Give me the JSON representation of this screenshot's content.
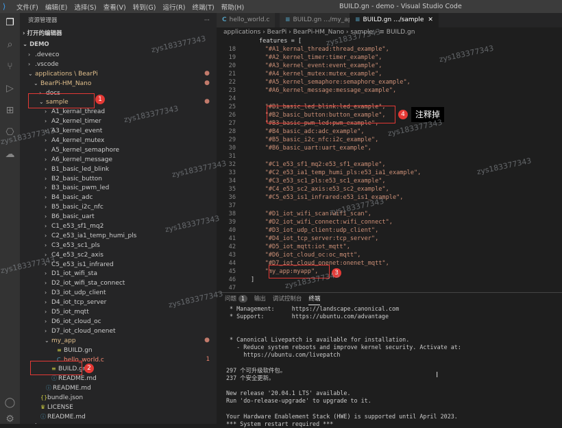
{
  "window": {
    "menu": [
      "文件(F)",
      "编辑(E)",
      "选择(S)",
      "查看(V)",
      "转到(G)",
      "运行(R)",
      "终端(T)",
      "帮助(H)"
    ],
    "title": "BUILD.gn - demo - Visual Studio Code"
  },
  "activity_icons": [
    "files-icon",
    "search-icon",
    "source-control-icon",
    "run-debug-icon",
    "extensions-icon",
    "remote-icon",
    "cloud-icon",
    "account-icon",
    "settings-gear-icon"
  ],
  "explorer": {
    "header": "资源管理器",
    "more": "···",
    "open_editors": "打开的编辑器",
    "workspace": "DEMO",
    "tree": [
      {
        "label": ".deveco",
        "depth": 1,
        "chev": "›"
      },
      {
        "label": ".vscode",
        "depth": 1,
        "chev": "›"
      },
      {
        "label": "applications \\ BearPi",
        "depth": 1,
        "chev": "⌄",
        "mod": true,
        "dot": "●"
      },
      {
        "label": "BearPi-HM_Nano",
        "depth": 2,
        "chev": "⌄",
        "mod": true,
        "dot": "●"
      },
      {
        "label": "docs",
        "depth": 3,
        "chev": "›"
      },
      {
        "label": "sample",
        "depth": 3,
        "chev": "⌄",
        "mod": true,
        "dot": "●"
      },
      {
        "label": "A1_kernal_thread",
        "depth": 4,
        "chev": "›"
      },
      {
        "label": "A2_kernel_timer",
        "depth": 4,
        "chev": "›"
      },
      {
        "label": "A3_kernel_event",
        "depth": 4,
        "chev": "›"
      },
      {
        "label": "A4_kernel_mutex",
        "depth": 4,
        "chev": "›"
      },
      {
        "label": "A5_kernel_semaphore",
        "depth": 4,
        "chev": "›"
      },
      {
        "label": "A6_kernel_message",
        "depth": 4,
        "chev": "›"
      },
      {
        "label": "B1_basic_led_blink",
        "depth": 4,
        "chev": "›"
      },
      {
        "label": "B2_basic_button",
        "depth": 4,
        "chev": "›"
      },
      {
        "label": "B3_basic_pwm_led",
        "depth": 4,
        "chev": "›"
      },
      {
        "label": "B4_basic_adc",
        "depth": 4,
        "chev": "›"
      },
      {
        "label": "B5_basic_i2c_nfc",
        "depth": 4,
        "chev": "›"
      },
      {
        "label": "B6_basic_uart",
        "depth": 4,
        "chev": "›"
      },
      {
        "label": "C1_e53_sf1_mq2",
        "depth": 4,
        "chev": "›"
      },
      {
        "label": "C2_e53_ia1_temp_humi_pls",
        "depth": 4,
        "chev": "›"
      },
      {
        "label": "C3_e53_sc1_pls",
        "depth": 4,
        "chev": "›"
      },
      {
        "label": "C4_e53_sc2_axis",
        "depth": 4,
        "chev": "›"
      },
      {
        "label": "C5_e53_is1_infrared",
        "depth": 4,
        "chev": "›"
      },
      {
        "label": "D1_iot_wifi_sta",
        "depth": 4,
        "chev": "›"
      },
      {
        "label": "D2_iot_wifi_sta_connect",
        "depth": 4,
        "chev": "›"
      },
      {
        "label": "D3_iot_udp_client",
        "depth": 4,
        "chev": "›"
      },
      {
        "label": "D4_iot_tcp_server",
        "depth": 4,
        "chev": "›"
      },
      {
        "label": "D5_iot_mqtt",
        "depth": 4,
        "chev": "›"
      },
      {
        "label": "D6_iot_cloud_oc",
        "depth": 4,
        "chev": "›"
      },
      {
        "label": "D7_iot_cloud_onenet",
        "depth": 4,
        "chev": "›"
      },
      {
        "label": "my_app",
        "depth": 4,
        "chev": "⌄",
        "mod": true,
        "dot": "●"
      },
      {
        "label": "BUILD.gn",
        "depth": 5,
        "chev": "",
        "icon": "≡"
      },
      {
        "label": "hello_world.c",
        "depth": 5,
        "chev": "",
        "icon": "C",
        "err": true,
        "badge": "1"
      },
      {
        "label": "BUILD.gn",
        "depth": 4,
        "chev": "",
        "icon": "≡"
      },
      {
        "label": "README.md",
        "depth": 4,
        "chev": "",
        "icon": "ⓘ"
      },
      {
        "label": "README.md",
        "depth": 3,
        "chev": "",
        "icon": "ⓘ"
      },
      {
        "label": "bundle.json",
        "depth": 2,
        "chev": "",
        "icon": "{}"
      },
      {
        "label": "LICENSE",
        "depth": 2,
        "chev": "",
        "icon": "♛"
      },
      {
        "label": "README.md",
        "depth": 2,
        "chev": "",
        "icon": "ⓘ"
      },
      {
        "label": "base",
        "depth": 1,
        "chev": "›"
      }
    ]
  },
  "tabs": [
    {
      "label": "hello_world.c",
      "icon": "C"
    },
    {
      "label": "BUILD.gn .../my_app",
      "icon": "≡"
    },
    {
      "label": "BUILD.gn .../sample",
      "icon": "≡",
      "active": true,
      "close": "✕"
    }
  ],
  "breadcrumb": "applications › BearPi › BearPi-HM_Nano › sample › ≡ BUILD.gn",
  "code": [
    {
      "n": "",
      "t": "features = [",
      "plain": true
    },
    {
      "n": "18",
      "t": "    \"#A1_kernal_thread:thread_example\","
    },
    {
      "n": "19",
      "t": "    \"#A2_kernel_timer:timer_example\","
    },
    {
      "n": "20",
      "t": "    \"#A3_kernel_event:event_example\","
    },
    {
      "n": "21",
      "t": "    \"#A4_kernel_mutex:mutex_example\","
    },
    {
      "n": "22",
      "t": "    \"#A5_kernel_semaphore:semaphore_example\","
    },
    {
      "n": "23",
      "t": "    \"#A6_kernel_message:message_example\","
    },
    {
      "n": "24",
      "t": ""
    },
    {
      "n": "25",
      "t": "    \"#B1_basic_led_blink:led_example\","
    },
    {
      "n": "26",
      "t": "    \"#B2_basic_button:button_example\","
    },
    {
      "n": "27",
      "t": "    \"#B3_basic_pwm_led:pwm_example\","
    },
    {
      "n": "28",
      "t": "    \"#B4_basic_adc:adc_example\","
    },
    {
      "n": "29",
      "t": "    \"#B5_basic_i2c_nfc:i2c_example\","
    },
    {
      "n": "30",
      "t": "    \"#B6_basic_uart:uart_example\","
    },
    {
      "n": "31",
      "t": ""
    },
    {
      "n": "32",
      "t": "    \"#C1_e53_sf1_mq2:e53_sf1_example\","
    },
    {
      "n": "33",
      "t": "    \"#C2_e53_ia1_temp_humi_pls:e53_ia1_example\","
    },
    {
      "n": "34",
      "t": "    \"#C3_e53_sc1_pls:e53_sc1_example\","
    },
    {
      "n": "35",
      "t": "    \"#C4_e53_sc2_axis:e53_sc2_example\","
    },
    {
      "n": "36",
      "t": "    \"#C5_e53_is1_infrared:e53_is1_example\","
    },
    {
      "n": "37",
      "t": ""
    },
    {
      "n": "38",
      "t": "    \"#D1_iot_wifi_scan:wifi_scan\","
    },
    {
      "n": "39",
      "t": "    \"#D2_iot_wifi_connect:wifi_connect\","
    },
    {
      "n": "40",
      "t": "    \"#D3_iot_udp_client:udp_client\","
    },
    {
      "n": "41",
      "t": "    \"#D4_iot_tcp_server:tcp_server\","
    },
    {
      "n": "42",
      "t": "    \"#D5_iot_mqtt:iot_mqtt\","
    },
    {
      "n": "43",
      "t": "    \"#D6_iot_cloud_oc:oc_mqtt\","
    },
    {
      "n": "44",
      "t": "    \"#D7_iot_cloud_onenet:onenet_mqtt\","
    },
    {
      "n": "45",
      "t": "    \"my_app:myapp\","
    },
    {
      "n": "46",
      "t": "]",
      "plain": true
    },
    {
      "n": "47",
      "t": ""
    }
  ],
  "panel": {
    "tabs": [
      "问题",
      "输出",
      "调试控制台",
      "终端"
    ],
    "problems_count": "1",
    "active_tab": "终端",
    "terminal_lines": [
      " * Management:     https://landscape.canonical.com",
      " * Support:        https://ubuntu.com/advantage",
      "",
      "",
      " * Canonical Livepatch is available for installation.",
      "   - Reduce system reboots and improve kernel security. Activate at:",
      "     https://ubuntu.com/livepatch",
      "",
      "297 个可升级软件包。",
      "237 个安全更新。",
      "",
      "New release '20.04.1 LTS' available.",
      "Run 'do-release-upgrade' to upgrade to it.",
      "",
      "Your Hardware Enablement Stack (HWE) is supported until April 2023.",
      "*** System restart required ***"
    ]
  },
  "annotations": {
    "n1": "1",
    "n2": "2",
    "n3": "3",
    "n4": "4",
    "note": "注释掉"
  },
  "watermark": "zys183377343",
  "cursor": "I",
  "colors": {
    "callout": "#e53935",
    "string": "#ce9178",
    "modified": "#e2c08d",
    "error": "#f48771"
  }
}
